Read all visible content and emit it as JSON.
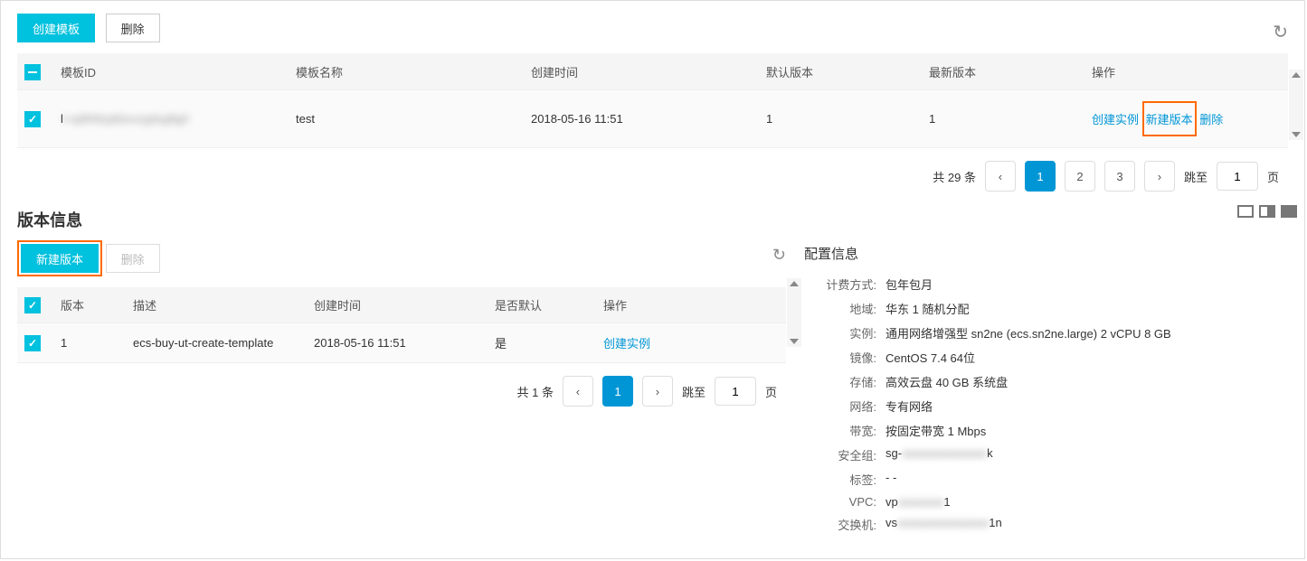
{
  "toolbar": {
    "create_template": "创建模板",
    "delete": "删除"
  },
  "templates": {
    "headers": {
      "id": "模板ID",
      "name": "模板名称",
      "created": "创建时间",
      "default_ver": "默认版本",
      "latest_ver": "最新版本",
      "ops": "操作"
    },
    "rows": [
      {
        "id": "l",
        "id_blur": "t-wj9h8zpkbxvzgdsg8g0",
        "name": "test",
        "created": "2018-05-16 11:51",
        "default_ver": "1",
        "latest_ver": "1"
      }
    ],
    "ops": {
      "create_instance": "创建实例",
      "new_version": "新建版本",
      "delete": "删除"
    },
    "pagination": {
      "total_label": "共 29 条",
      "pages": [
        "1",
        "2",
        "3"
      ],
      "jump_label": "跳至",
      "jump_val": "1",
      "page_suffix": "页"
    }
  },
  "versions": {
    "section_title": "版本信息",
    "btn_new_version": "新建版本",
    "btn_delete": "删除",
    "headers": {
      "version": "版本",
      "desc": "描述",
      "created": "创建时间",
      "is_default": "是否默认",
      "ops": "操作"
    },
    "rows": [
      {
        "version": "1",
        "desc": "ecs-buy-ut-create-template",
        "created": "2018-05-16 11:51",
        "is_default": "是"
      }
    ],
    "ops": {
      "create_instance": "创建实例"
    },
    "pagination": {
      "total_label": "共 1 条",
      "jump_label": "跳至",
      "jump_val": "1",
      "page_suffix": "页"
    }
  },
  "config": {
    "title": "配置信息",
    "rows": {
      "billing": {
        "label": "计费方式:",
        "value": "包年包月"
      },
      "region": {
        "label": "地域:",
        "value": "华东 1 随机分配"
      },
      "instance": {
        "label": "实例:",
        "value": "通用网络增强型 sn2ne (ecs.sn2ne.large) 2 vCPU 8 GB"
      },
      "image": {
        "label": "镜像:",
        "value": "CentOS 7.4 64位"
      },
      "storage": {
        "label": "存储:",
        "value": "高效云盘 40 GB 系统盘"
      },
      "network": {
        "label": "网络:",
        "value": "专有网络"
      },
      "bandwidth": {
        "label": "带宽:",
        "value": "按固定带宽 1 Mbps"
      },
      "secgroup": {
        "label": "安全组:",
        "value_prefix": "sg-",
        "value_blur": "aaaaaaaaaaaaa",
        "value_suffix": "k"
      },
      "tag": {
        "label": "标签:",
        "value": "- -"
      },
      "vpc": {
        "label": "VPC:",
        "value_prefix": "vp",
        "value_blur": "aaaaaaa",
        "value_suffix": "1"
      },
      "vswitch": {
        "label": "交换机:",
        "value_prefix": "vs",
        "value_blur": "aaaaaaaaaaaaaa",
        "value_suffix": "1n"
      }
    }
  }
}
